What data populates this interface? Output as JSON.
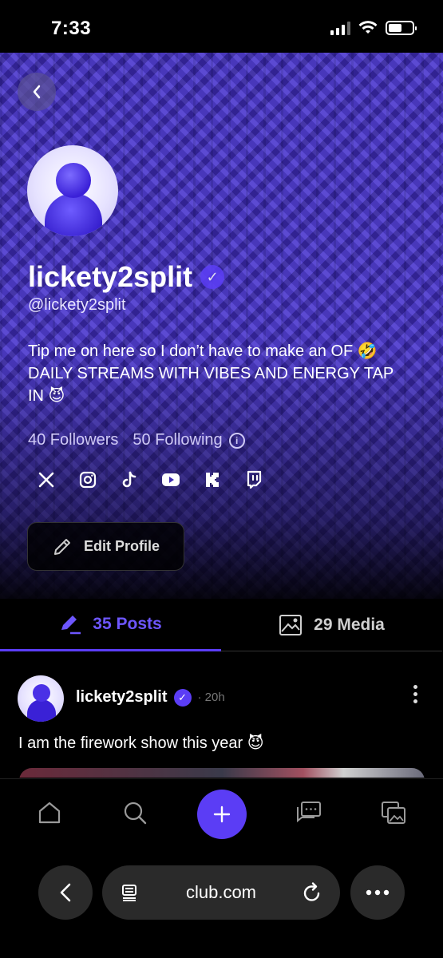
{
  "status_bar": {
    "time": "7:33"
  },
  "profile": {
    "display_name": "lickety2split",
    "handle": "@lickety2split",
    "bio": "Tip me on here so I don’t have to make an OF 🤣 DAILY STREAMS WITH VIBES AND ENERGY TAP IN 😈",
    "followers": "40 Followers",
    "following": "50 Following",
    "edit_label": "Edit Profile",
    "socials": [
      "x-icon",
      "instagram-icon",
      "tiktok-icon",
      "youtube-icon",
      "kick-icon",
      "twitch-icon"
    ],
    "accent": "#5b3df5"
  },
  "tabs": [
    {
      "label": "35 Posts",
      "active": true
    },
    {
      "label": "29 Media",
      "active": false
    }
  ],
  "post": {
    "author": "lickety2split",
    "time": "· 20h",
    "text": "I am the firework show this year 😈"
  },
  "browser": {
    "url": "club.com"
  }
}
